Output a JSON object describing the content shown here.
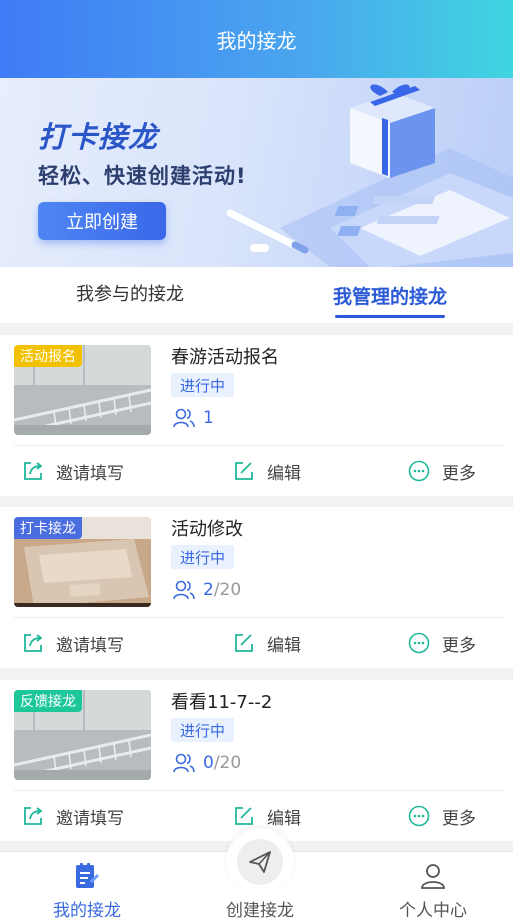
{
  "header": {
    "title": "我的接龙"
  },
  "banner": {
    "title": "打卡接龙",
    "subtitle": "轻松、快速创建活动!",
    "button_label": "立即创建"
  },
  "tabs": [
    {
      "label": "我参与的接龙",
      "active": false
    },
    {
      "label": "我管理的接龙",
      "active": true
    }
  ],
  "colors": {
    "accent": "#2a5ad6",
    "tag_signup": "#f2c200",
    "tag_checkin": "#4a6de0",
    "tag_feedback": "#1ec79a",
    "icon_teal": "#1fb89a"
  },
  "cards": [
    {
      "tag": "活动报名",
      "title": "春游活动报名",
      "status": "进行中",
      "count": "1",
      "max": "",
      "thumb": "railing"
    },
    {
      "tag": "打卡接龙",
      "title": "活动修改",
      "status": "进行中",
      "count": "2",
      "max": "/20",
      "thumb": "laptop"
    },
    {
      "tag": "反馈接龙",
      "title": "看看11-7--2",
      "status": "进行中",
      "count": "0",
      "max": "/20",
      "thumb": "railing"
    }
  ],
  "actions": {
    "invite": "邀请填写",
    "edit": "编辑",
    "more": "更多"
  },
  "bottom_nav": {
    "mine": "我的接龙",
    "create": "创建接龙",
    "profile": "个人中心"
  }
}
